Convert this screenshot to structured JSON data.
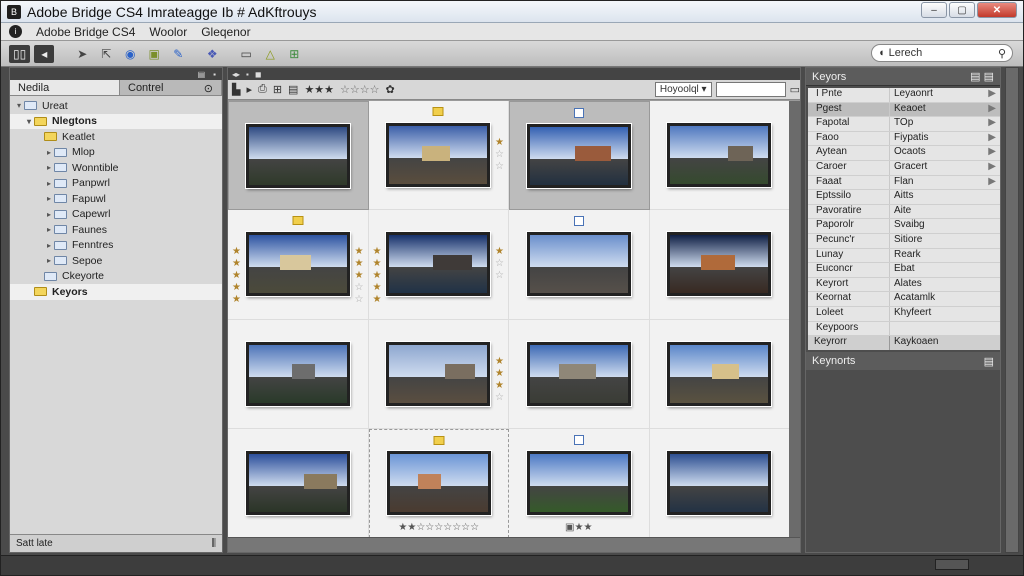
{
  "window": {
    "title": "Adobe Bridge CS4  Imrateagge Ib # AdKftrouys",
    "controls": [
      "–",
      "▢",
      "✕"
    ]
  },
  "app_header": {
    "name": "Adobe Bridge CS4",
    "menu": [
      "Woolor",
      "Gleqenor"
    ]
  },
  "toolbar": {
    "icons": [
      "folders-icon",
      "back-icon",
      "arrow-icon",
      "pointer-icon",
      "help-icon",
      "camera-icon",
      "pen-icon",
      "refine-icon",
      "open-icon",
      "warning-icon",
      "output-icon"
    ]
  },
  "search": {
    "placeholder": "Lerech"
  },
  "left_panel": {
    "tab_active": "Nedila",
    "tab_inactive": "Contrel",
    "tree": [
      {
        "label": "Ureat",
        "depth": 0,
        "arrow": "▾",
        "yellow": false,
        "selected": false
      },
      {
        "label": "Nlegtons",
        "depth": 1,
        "arrow": "▾",
        "yellow": true,
        "selected": true
      },
      {
        "label": "Keatlet",
        "depth": 2,
        "arrow": "",
        "yellow": true,
        "selected": false
      },
      {
        "label": "Mlop",
        "depth": 3,
        "arrow": "▸",
        "yellow": false,
        "selected": false
      },
      {
        "label": "Wonntible",
        "depth": 3,
        "arrow": "▸",
        "yellow": false,
        "selected": false
      },
      {
        "label": "Panpwrl",
        "depth": 3,
        "arrow": "▸",
        "yellow": false,
        "selected": false
      },
      {
        "label": "Fapuwl",
        "depth": 3,
        "arrow": "▸",
        "yellow": false,
        "selected": false
      },
      {
        "label": "Capewrl",
        "depth": 3,
        "arrow": "▸",
        "yellow": false,
        "selected": false
      },
      {
        "label": "Faunes",
        "depth": 3,
        "arrow": "▸",
        "yellow": false,
        "selected": false
      },
      {
        "label": "Fenntres",
        "depth": 3,
        "arrow": "▸",
        "yellow": false,
        "selected": false
      },
      {
        "label": "Sepoe",
        "depth": 3,
        "arrow": "▸",
        "yellow": false,
        "selected": false
      },
      {
        "label": "Ckeyorte",
        "depth": 2,
        "arrow": "",
        "yellow": false,
        "selected": false
      },
      {
        "label": "Keyors",
        "depth": 1,
        "arrow": "",
        "yellow": true,
        "selected": true
      }
    ],
    "footer": "Satt late"
  },
  "center_panel": {
    "toolbar_stars": "★★★",
    "filter_label": "Hoyoolql",
    "filter_stars": "☆☆☆☆"
  },
  "thumbnails": [
    {
      "sky": "#2e4a82",
      "ground": "#2f3a2a",
      "bldg": "",
      "marker": "",
      "selected": true,
      "dashed": false,
      "stars_left": [],
      "stars_right": [],
      "stars_bottom": ""
    },
    {
      "sky": "#3b5ea8",
      "ground": "#5a4d3d",
      "bldg": "#c9b27d",
      "marker": "yellow",
      "selected": false,
      "dashed": false,
      "stars_left": [],
      "stars_right": [
        "★",
        "☆",
        "☆"
      ],
      "stars_bottom": ""
    },
    {
      "sky": "#3360b2",
      "ground": "#223040",
      "bldg": "#9a5b3c",
      "marker": "blue",
      "selected": true,
      "dashed": false,
      "stars_left": [],
      "stars_right": [],
      "stars_bottom": ""
    },
    {
      "sky": "#4f78bf",
      "ground": "#354a2e",
      "bldg": "#6e6457",
      "marker": "",
      "selected": false,
      "dashed": false,
      "stars_left": [],
      "stars_right": [],
      "stars_bottom": ""
    },
    {
      "sky": "#2d53a1",
      "ground": "#4b4a3a",
      "bldg": "#d8c79c",
      "marker": "yellow",
      "selected": false,
      "dashed": false,
      "stars_left": [
        "★",
        "★",
        "★",
        "★",
        "★"
      ],
      "stars_right": [
        "★",
        "★",
        "★",
        "☆",
        "☆"
      ],
      "stars_bottom": ""
    },
    {
      "sky": "#16306a",
      "ground": "#203246",
      "bldg": "#3f3a38",
      "marker": "",
      "selected": false,
      "dashed": false,
      "stars_left": [
        "★",
        "★",
        "★",
        "★",
        "★"
      ],
      "stars_right": [
        "★",
        "☆",
        "☆"
      ],
      "stars_bottom": ""
    },
    {
      "sky": "#6a8fcc",
      "ground": "#56504a",
      "bldg": "",
      "marker": "blue",
      "selected": false,
      "dashed": false,
      "stars_left": [],
      "stars_right": [],
      "stars_bottom": ""
    },
    {
      "sky": "#0f1f44",
      "ground": "#382a22",
      "bldg": "#b06a3a",
      "marker": "",
      "selected": false,
      "dashed": false,
      "stars_left": [],
      "stars_right": [],
      "stars_bottom": ""
    },
    {
      "sky": "#4d74b8",
      "ground": "#2a3a2a",
      "bldg": "#6d6d6d",
      "marker": "",
      "selected": false,
      "dashed": false,
      "stars_left": [],
      "stars_right": [],
      "stars_bottom": ""
    },
    {
      "sky": "#8ea7cf",
      "ground": "#5a4e40",
      "bldg": "#7a6e60",
      "marker": "",
      "selected": false,
      "dashed": false,
      "stars_left": [],
      "stars_right": [
        "★",
        "★",
        "★",
        "☆"
      ],
      "stars_bottom": ""
    },
    {
      "sky": "#3d6ab5",
      "ground": "#3a3c35",
      "bldg": "#8f8778",
      "marker": "",
      "selected": false,
      "dashed": false,
      "stars_left": [],
      "stars_right": [],
      "stars_bottom": ""
    },
    {
      "sky": "#5a86c9",
      "ground": "#5a5240",
      "bldg": "#d6c08a",
      "marker": "",
      "selected": false,
      "dashed": false,
      "stars_left": [],
      "stars_right": [],
      "stars_bottom": ""
    },
    {
      "sky": "#2c4f9b",
      "ground": "#2b3527",
      "bldg": "#8a7a5e",
      "marker": "",
      "selected": false,
      "dashed": false,
      "stars_left": [],
      "stars_right": [],
      "stars_bottom": ""
    },
    {
      "sky": "#6b95d6",
      "ground": "#4a3b30",
      "bldg": "#c0825a",
      "marker": "yellow",
      "selected": false,
      "dashed": true,
      "stars_left": [],
      "stars_right": [],
      "stars_bottom": "★★☆☆☆☆☆☆☆"
    },
    {
      "sky": "#4c79c4",
      "ground": "#355a2a",
      "bldg": "",
      "marker": "blue",
      "selected": false,
      "dashed": false,
      "stars_left": [],
      "stars_right": [],
      "stars_bottom": "▣★★"
    },
    {
      "sky": "#2d4f91",
      "ground": "#233244",
      "bldg": "",
      "marker": "",
      "selected": false,
      "dashed": false,
      "stars_left": [],
      "stars_right": [],
      "stars_bottom": ""
    }
  ],
  "right_panel": {
    "header": "Keyors",
    "keywords": [
      {
        "left": "I Pnte",
        "right": "Leyaonrt",
        "chev": "▶",
        "selected": false
      },
      {
        "left": "Pgest",
        "right": "Keaoet",
        "chev": "▶",
        "selected": true
      },
      {
        "left": "Fapotal",
        "right": "TOp",
        "chev": "▶",
        "selected": false
      },
      {
        "left": "Faoo",
        "right": "Fiypatis",
        "chev": "▶",
        "selected": false
      },
      {
        "left": "Aytean",
        "right": "Ocaots",
        "chev": "▶",
        "selected": false
      },
      {
        "left": "Caroer",
        "right": "Gracert",
        "chev": "▶",
        "selected": false
      },
      {
        "left": "Faaat",
        "right": "Flan",
        "chev": "▶",
        "selected": false
      },
      {
        "left": "Eptssilo",
        "right": "Aitts",
        "chev": "",
        "selected": false
      },
      {
        "left": "Pavoratire",
        "right": "Aite",
        "chev": "",
        "selected": false
      },
      {
        "left": "Paporolr",
        "right": "Svaibg",
        "chev": "",
        "selected": false
      },
      {
        "left": "Pecunc'r",
        "right": "Sitiore",
        "chev": "",
        "selected": false
      },
      {
        "left": "Lunay",
        "right": "Reark",
        "chev": "",
        "selected": false
      },
      {
        "left": "Euconcr",
        "right": "Ebat",
        "chev": "",
        "selected": false
      },
      {
        "left": "Keyrort",
        "right": "Alates",
        "chev": "",
        "selected": false
      },
      {
        "left": "Keornat",
        "right": "Acatamlk",
        "chev": "",
        "selected": false
      },
      {
        "left": "Loleet",
        "right": "Khyfeert",
        "chev": "",
        "selected": false
      },
      {
        "left": "Keypoors",
        "right": "",
        "chev": "",
        "selected": false
      }
    ],
    "footer": {
      "left": "Keyrorr",
      "right": "Kaykoaen"
    },
    "second_header": "Keynorts"
  }
}
